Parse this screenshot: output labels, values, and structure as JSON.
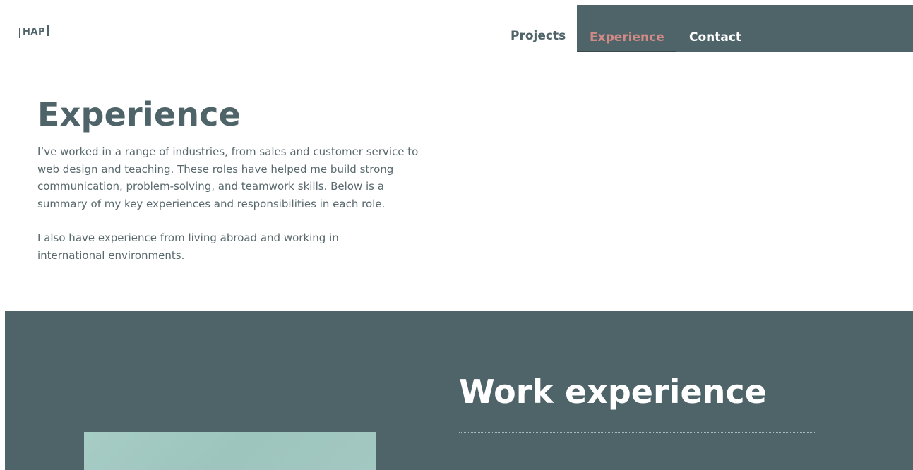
{
  "header": {
    "logo_text": "HAP",
    "nav": [
      {
        "label": "Projects"
      },
      {
        "label": "Experience",
        "active": true
      },
      {
        "label": "Contact"
      }
    ]
  },
  "intro": {
    "title": "Experience",
    "paragraphs": [
      "I’ve worked in a range of industries, from sales and customer service to web design and teaching. These roles have helped me build strong communication, problem-solving, and teamwork skills. Below is a summary of my key experiences and responsibilities in each role.",
      "I also have experience from living abroad and working in international environments."
    ]
  },
  "work": {
    "title": "Work experience"
  },
  "colors": {
    "primary": "#4f6469",
    "accent": "#d28a87",
    "text": "#59696d",
    "image_tint": "#a3c8c2"
  }
}
